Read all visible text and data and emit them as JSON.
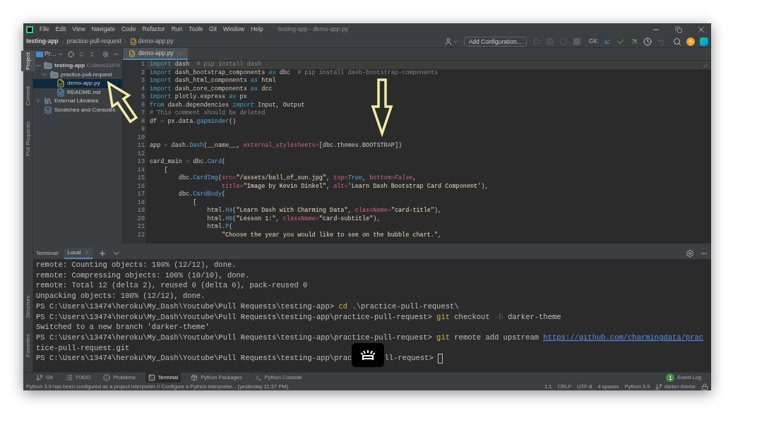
{
  "window": {
    "title": "testing-app - demo-app.py"
  },
  "menu": [
    "File",
    "Edit",
    "View",
    "Navigate",
    "Code",
    "Refactor",
    "Run",
    "Tools",
    "Git",
    "Window",
    "Help"
  ],
  "breadcrumbs": [
    "testing-app",
    "practice-pull-request",
    "demo-app.py"
  ],
  "toolbar": {
    "run_config": "Add Configuration...",
    "git_label": "Git:"
  },
  "side_tabs_top": [
    {
      "label": "Project",
      "selected": true
    },
    {
      "label": "Commit",
      "selected": false
    },
    {
      "label": "Pull Requests",
      "selected": false
    }
  ],
  "side_tabs_bottom": [
    {
      "label": "Structure",
      "selected": false
    },
    {
      "label": "Favorites",
      "selected": false
    }
  ],
  "project_panel": {
    "view": "Pr…",
    "tree": [
      {
        "label": "testing-app",
        "kind": "project",
        "path": "C:\\Users\\13474\\",
        "expanded": true,
        "selected": false,
        "children": [
          {
            "label": "practice-pull-request",
            "kind": "folder",
            "expanded": true,
            "selected": false,
            "children": [
              {
                "label": "demo-app.py",
                "kind": "python",
                "selected": true
              },
              {
                "label": "README.md",
                "kind": "markdown",
                "selected": false
              }
            ]
          }
        ]
      },
      {
        "label": "External Libraries",
        "kind": "library",
        "expanded": false,
        "selected": false
      },
      {
        "label": "Scratches and Consoles",
        "kind": "scratch",
        "selected": false
      }
    ]
  },
  "editor": {
    "tabs": [
      {
        "label": "demo-app.py",
        "selected": true
      }
    ],
    "lines": [
      {
        "number": "1",
        "current": true,
        "tokens": [
          {
            "kind": "kw",
            "text": "import"
          },
          {
            "kind": "text",
            "text": " dash  "
          },
          {
            "kind": "cm",
            "text": "# pip install dash"
          }
        ]
      },
      {
        "number": "2",
        "current": false,
        "tokens": [
          {
            "kind": "kw",
            "text": "import"
          },
          {
            "kind": "text",
            "text": " dash_bootstrap_components "
          },
          {
            "kind": "kwi",
            "text": "as"
          },
          {
            "kind": "text",
            "text": " dbc  "
          },
          {
            "kind": "cm",
            "text": "# pip install dash-bootstrap-components"
          }
        ]
      },
      {
        "number": "3",
        "current": false,
        "tokens": [
          {
            "kind": "kw",
            "text": "import"
          },
          {
            "kind": "text",
            "text": " dash_html_components "
          },
          {
            "kind": "kwi",
            "text": "as"
          },
          {
            "kind": "text",
            "text": " html"
          }
        ]
      },
      {
        "number": "4",
        "current": false,
        "tokens": [
          {
            "kind": "kw",
            "text": "import"
          },
          {
            "kind": "text",
            "text": " dash_core_components "
          },
          {
            "kind": "kwi",
            "text": "as"
          },
          {
            "kind": "text",
            "text": " dcc"
          }
        ]
      },
      {
        "number": "5",
        "current": false,
        "tokens": [
          {
            "kind": "kw",
            "text": "import"
          },
          {
            "kind": "text",
            "text": " plotly.express "
          },
          {
            "kind": "kwi",
            "text": "as"
          },
          {
            "kind": "text",
            "text": " px"
          }
        ]
      },
      {
        "number": "6",
        "current": false,
        "tokens": [
          {
            "kind": "kw",
            "text": "from"
          },
          {
            "kind": "text",
            "text": " dash.dependencies "
          },
          {
            "kind": "kwi",
            "text": "import"
          },
          {
            "kind": "text",
            "text": " Input, Output"
          }
        ]
      },
      {
        "number": "7",
        "current": false,
        "tokens": [
          {
            "kind": "cm",
            "text": "# This comment should be deleted"
          }
        ]
      },
      {
        "number": "8",
        "current": false,
        "tokens": [
          {
            "kind": "text",
            "text": "df "
          },
          {
            "kind": "param",
            "text": "="
          },
          {
            "kind": "text",
            "text": " px.data."
          },
          {
            "kind": "fn",
            "text": "gapminder"
          },
          {
            "kind": "text",
            "text": "()"
          }
        ]
      },
      {
        "number": "9",
        "current": false
      },
      {
        "number": "10",
        "current": false
      },
      {
        "number": "11",
        "current": false,
        "tokens": [
          {
            "kind": "text",
            "text": "app "
          },
          {
            "kind": "param",
            "text": "="
          },
          {
            "kind": "text",
            "text": " dash."
          },
          {
            "kind": "fn",
            "text": "Dash"
          },
          {
            "kind": "text",
            "text": "(__name__, "
          },
          {
            "kind": "param",
            "text": "external_stylesheets="
          },
          {
            "kind": "text",
            "text": "[dbc.themes.BOOTSTRAP])"
          }
        ]
      },
      {
        "number": "12",
        "current": false
      },
      {
        "number": "13",
        "current": false,
        "tokens": [
          {
            "kind": "text",
            "text": "card_main "
          },
          {
            "kind": "param",
            "text": "="
          },
          {
            "kind": "text",
            "text": " dbc."
          },
          {
            "kind": "fn",
            "text": "Card"
          },
          {
            "kind": "text",
            "text": "("
          }
        ]
      },
      {
        "number": "14",
        "current": false,
        "tokens": [
          {
            "kind": "text",
            "text": "    ["
          }
        ]
      },
      {
        "number": "15",
        "current": false,
        "tokens": [
          {
            "kind": "text",
            "text": "        dbc."
          },
          {
            "kind": "fn",
            "text": "CardImg"
          },
          {
            "kind": "text",
            "text": "("
          },
          {
            "kind": "param",
            "text": "src="
          },
          {
            "kind": "str",
            "text": "\"/assets/ball_of_sun.jpg\""
          },
          {
            "kind": "text",
            "text": ", "
          },
          {
            "kind": "param",
            "text": "top="
          },
          {
            "kind": "const",
            "text": "True"
          },
          {
            "kind": "text",
            "text": ", "
          },
          {
            "kind": "param",
            "text": "bottom="
          },
          {
            "kind": "const-alt",
            "text": "False"
          },
          {
            "kind": "text",
            "text": ","
          }
        ]
      },
      {
        "number": "16",
        "current": false,
        "tokens": [
          {
            "kind": "param",
            "text": "                    title="
          },
          {
            "kind": "str",
            "text": "\"Image by Kevin Dinkel\""
          },
          {
            "kind": "text",
            "text": ", "
          },
          {
            "kind": "param",
            "text": "alt="
          },
          {
            "kind": "str",
            "text": "'Learn Dash Bootstrap Card Component'"
          },
          {
            "kind": "text",
            "text": "),"
          }
        ]
      },
      {
        "number": "17",
        "current": false,
        "tokens": [
          {
            "kind": "text",
            "text": "        dbc."
          },
          {
            "kind": "fn",
            "text": "CardBody"
          },
          {
            "kind": "text",
            "text": "("
          }
        ]
      },
      {
        "number": "18",
        "current": false,
        "tokens": [
          {
            "kind": "text",
            "text": "            ["
          }
        ]
      },
      {
        "number": "19",
        "current": false,
        "tokens": [
          {
            "kind": "text",
            "text": "                html."
          },
          {
            "kind": "fn",
            "text": "H4"
          },
          {
            "kind": "text",
            "text": "("
          },
          {
            "kind": "str",
            "text": "\"Learn Dash with Charming Data\""
          },
          {
            "kind": "text",
            "text": ", "
          },
          {
            "kind": "param",
            "text": "className="
          },
          {
            "kind": "str",
            "text": "\"card-title\""
          },
          {
            "kind": "text",
            "text": "),"
          }
        ]
      },
      {
        "number": "20",
        "current": false,
        "tokens": [
          {
            "kind": "text",
            "text": "                html."
          },
          {
            "kind": "fn",
            "text": "H6"
          },
          {
            "kind": "text",
            "text": "("
          },
          {
            "kind": "str",
            "text": "\"Lesson 1:\""
          },
          {
            "kind": "text",
            "text": ", "
          },
          {
            "kind": "param",
            "text": "className="
          },
          {
            "kind": "str",
            "text": "\"card-subtitle\""
          },
          {
            "kind": "text",
            "text": "),"
          }
        ]
      },
      {
        "number": "21",
        "current": false,
        "tokens": [
          {
            "kind": "text",
            "text": "                html."
          },
          {
            "kind": "fn",
            "text": "P"
          },
          {
            "kind": "text",
            "text": "("
          }
        ]
      },
      {
        "number": "22",
        "current": false,
        "tokens": [
          {
            "kind": "str",
            "text": "                    \"Choose the year you would like to see on the bubble chart.\""
          },
          {
            "kind": "text",
            "text": ","
          }
        ]
      }
    ]
  },
  "terminal": {
    "label": "Terminal:",
    "tabs": [
      {
        "label": "Local",
        "selected": true
      }
    ],
    "lines": [
      {
        "tokens": [
          {
            "kind": "text",
            "text": "remote: Counting objects: 100% (12/12), done."
          }
        ]
      },
      {
        "tokens": [
          {
            "kind": "text",
            "text": "remote: Compressing objects: 100% (10/10), done."
          }
        ]
      },
      {
        "tokens": [
          {
            "kind": "text",
            "text": "remote: Total 12 (delta 2), reused 0 (delta 0), pack-reused 0"
          }
        ]
      },
      {
        "tokens": [
          {
            "kind": "text",
            "text": "Unpacking objects: 100% (12/12), done."
          }
        ]
      },
      {
        "tokens": [
          {
            "kind": "text",
            "text": "PS C:\\Users\\13474\\heroku\\My_Dash\\Youtube\\Pull Requests\\testing-app> "
          },
          {
            "kind": "cmd",
            "text": "cd"
          },
          {
            "kind": "text",
            "text": " .\\practice-pull-request\\"
          }
        ]
      },
      {
        "tokens": [
          {
            "kind": "text",
            "text": "PS C:\\Users\\13474\\heroku\\My_Dash\\Youtube\\Pull Requests\\testing-app\\practice-pull-request> "
          },
          {
            "kind": "cmd",
            "text": "git"
          },
          {
            "kind": "text",
            "text": " checkout "
          },
          {
            "kind": "flag",
            "text": "-b"
          },
          {
            "kind": "text",
            "text": " darker-theme"
          }
        ]
      },
      {
        "tokens": [
          {
            "kind": "text",
            "text": "Switched to a new branch 'darker-theme'"
          }
        ]
      },
      {
        "tokens": [
          {
            "kind": "text",
            "text": "PS C:\\Users\\13474\\heroku\\My_Dash\\Youtube\\Pull Requests\\testing-app\\practice-pull-request> "
          },
          {
            "kind": "cmd",
            "text": "git"
          },
          {
            "kind": "text",
            "text": " remote add upstream "
          },
          {
            "kind": "link",
            "text": "https://github.com/charmingdata/prac"
          }
        ]
      },
      {
        "tokens": [
          {
            "kind": "text",
            "text": "tice-pull-request.git"
          }
        ]
      },
      {
        "tokens": [
          {
            "kind": "text",
            "text": "PS C:\\Users\\13474\\heroku\\My_Dash\\Youtube\\Pull Requests\\testing-app\\prac"
          },
          {
            "kind": "overlay"
          },
          {
            "kind": "text",
            "text": "ll-request> "
          },
          {
            "kind": "cursor"
          }
        ]
      }
    ]
  },
  "tool_tabs": [
    {
      "label": "Git",
      "kind": "git",
      "selected": false
    },
    {
      "label": "TODO",
      "kind": "todo",
      "selected": false
    },
    {
      "label": "Problems",
      "kind": "problems",
      "selected": false
    },
    {
      "label": "Terminal",
      "kind": "terminal",
      "selected": true
    },
    {
      "label": "Python Packages",
      "kind": "packages",
      "selected": false
    },
    {
      "label": "Python Console",
      "kind": "console",
      "selected": false
    }
  ],
  "event_log": {
    "label": "Event Log",
    "count": "1"
  },
  "status_bar": {
    "message": "Python 3.9 has been configured as a project interpreter // Configure a Python interpreter... (yesterday 11:37 PM)",
    "items": [
      "1:1",
      "CRLF",
      "UTF-8",
      "4 spaces",
      "Python 3.9"
    ],
    "branch": "darker-theme"
  }
}
